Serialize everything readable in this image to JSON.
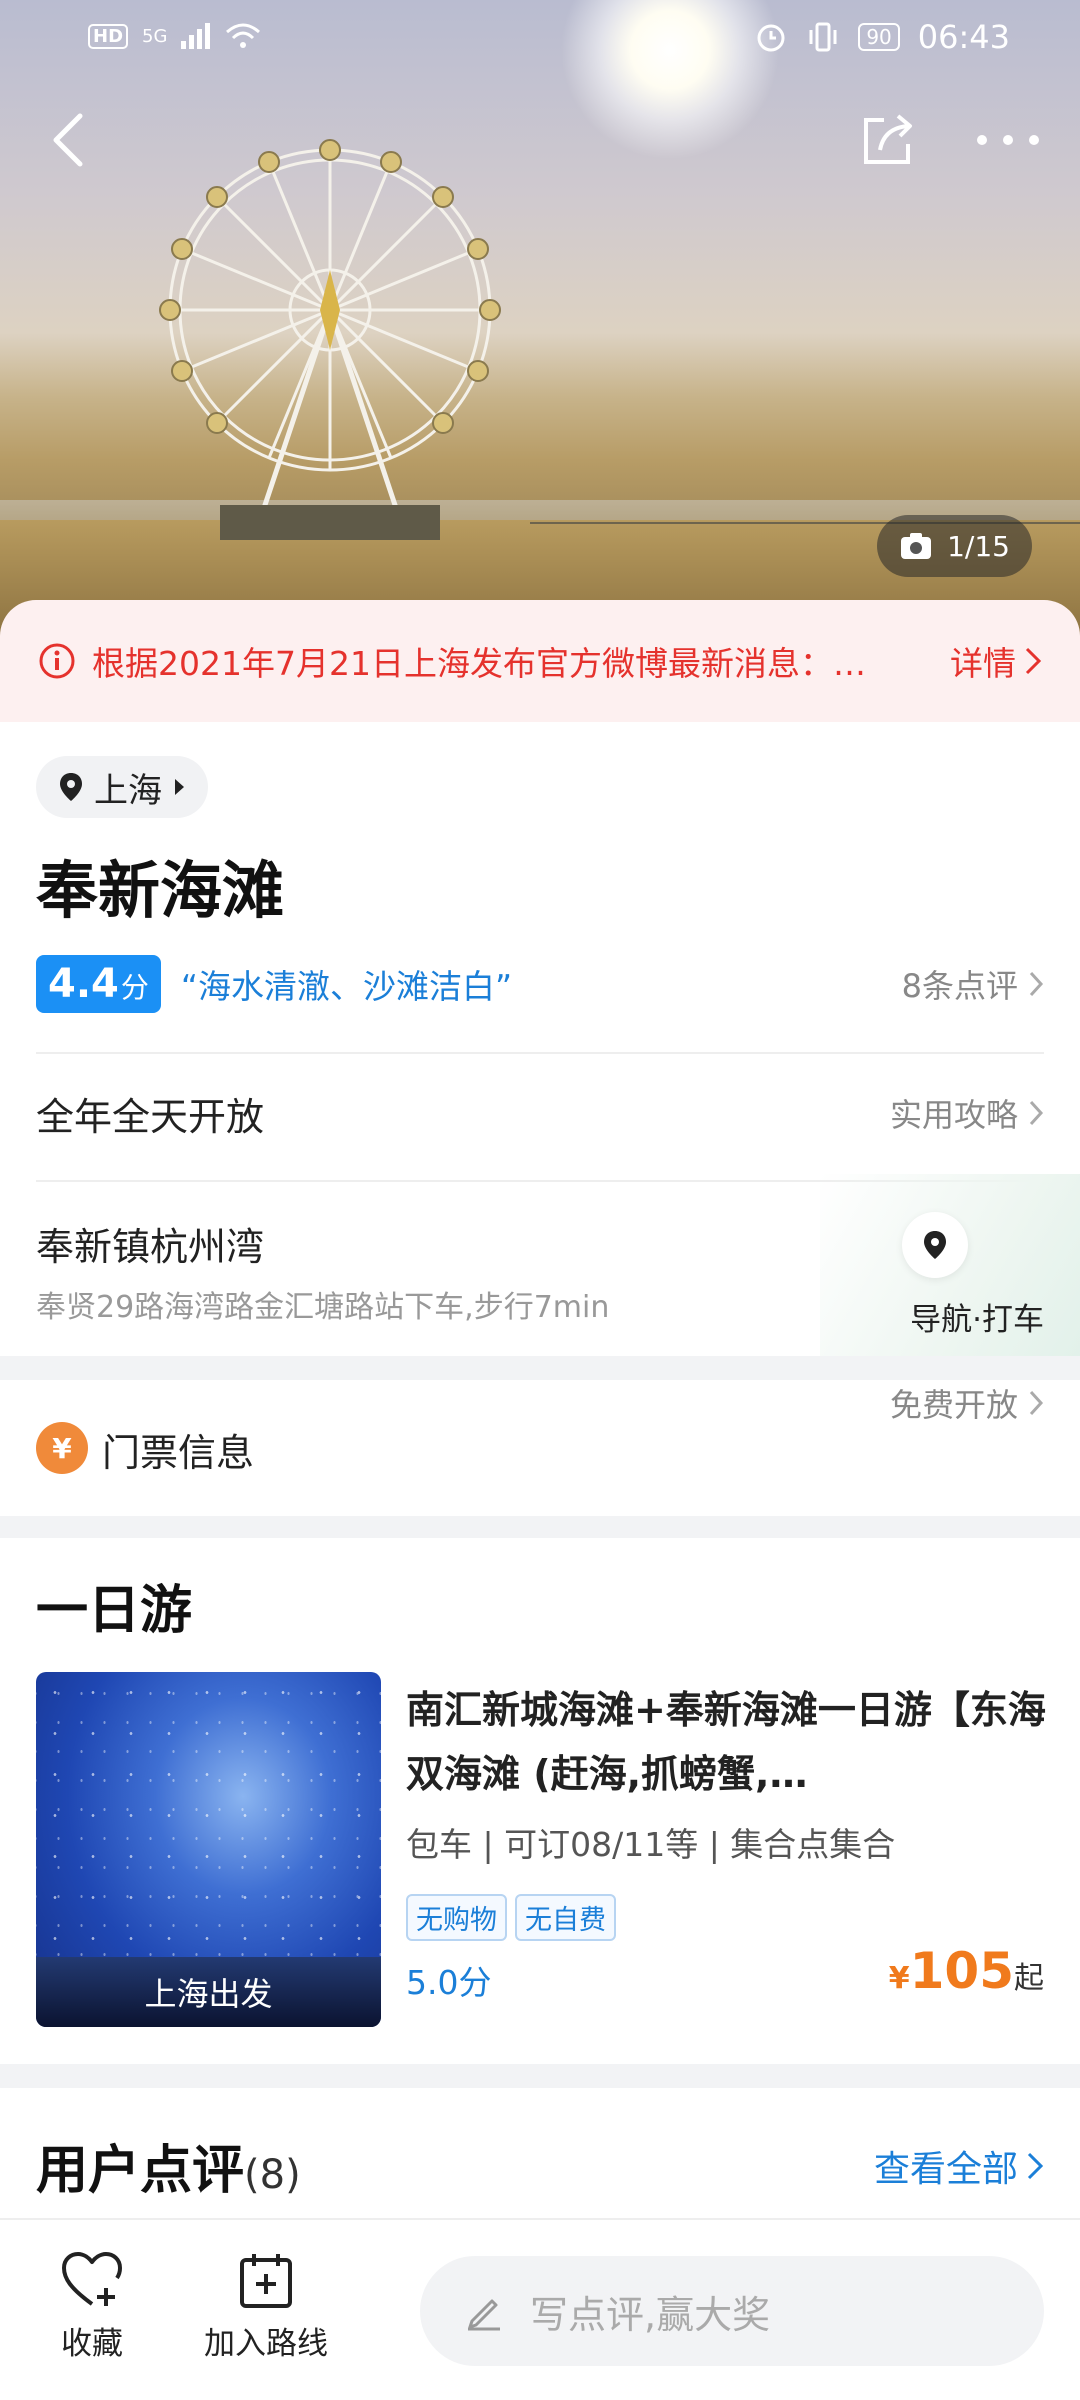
{
  "status_bar": {
    "hd": "HD",
    "network": "5G",
    "battery": "90",
    "time": "06:43"
  },
  "hero": {
    "photo_counter": "1/15"
  },
  "notice": {
    "text": "根据2021年7月21日上海发布官方微博最新消息：…",
    "detail": "详情"
  },
  "place": {
    "city": "上海",
    "name": "奉新海滩",
    "score": "4.4",
    "score_unit": "分",
    "quote": "“海水清澈、沙滩洁白”",
    "review_link": "8条点评",
    "hours": "全年全天开放",
    "guide_link": "实用攻略",
    "address": "奉新镇杭州湾",
    "transit": "奉贤29路海湾路金汇塘路站下车,步行7min",
    "navigate": "导航·打车"
  },
  "ticket": {
    "icon_text": "¥",
    "label": "门票信息",
    "value": "免费开放"
  },
  "tour_section": {
    "title": "一日游",
    "item": {
      "image_caption": "上海出发",
      "title": "南汇新城海滩+奉新海滩一日游【东海双海滩 (赶海,抓螃蟹,…",
      "meta": "包车 | 可订08/11等 | 集合点集合",
      "tags": [
        "无购物",
        "无自费"
      ],
      "score": "5.0分",
      "price_currency": "¥",
      "price": "105",
      "price_suffix": "起"
    }
  },
  "reviews": {
    "title": "用户点评",
    "count": "(8)",
    "view_all": "查看全部"
  },
  "bottom_bar": {
    "favorite": "收藏",
    "add_route": "加入路线",
    "comment_placeholder": "写点评,赢大奖"
  }
}
